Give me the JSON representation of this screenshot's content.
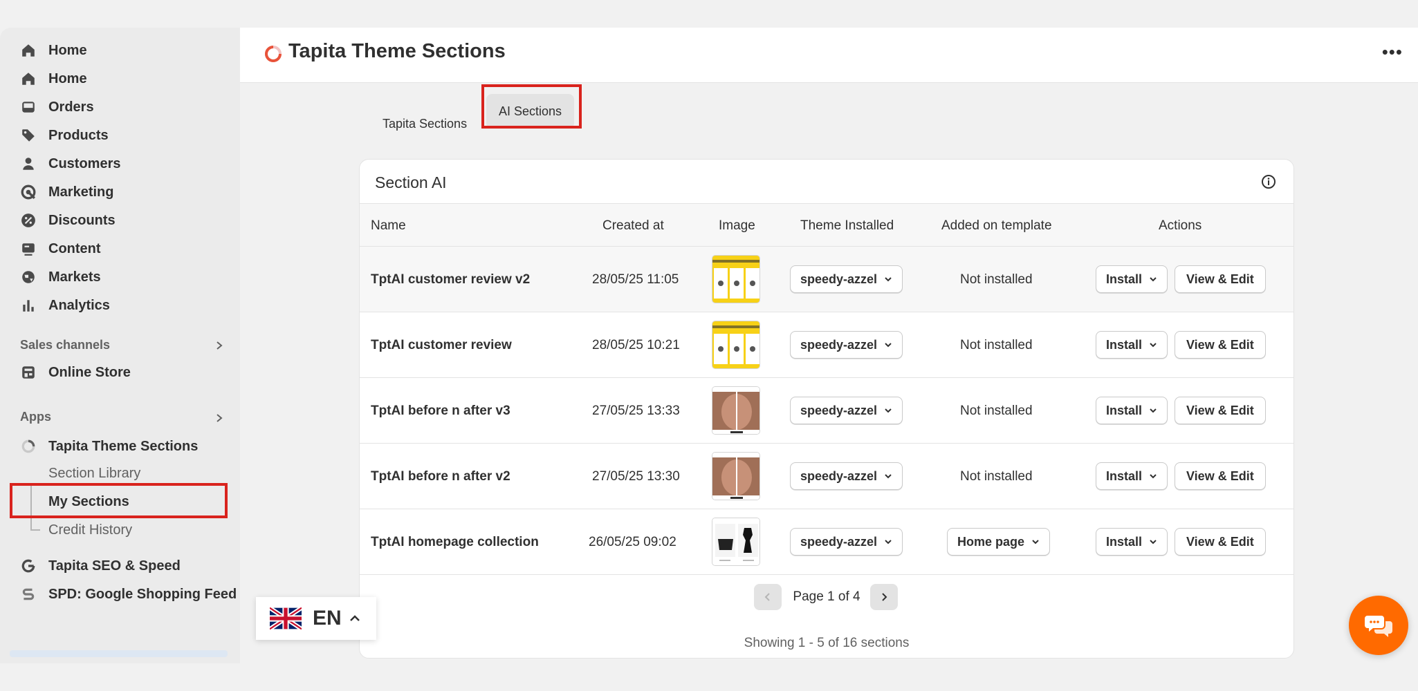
{
  "sidebar": {
    "items": [
      {
        "label": "Home",
        "icon": "home-icon"
      },
      {
        "label": "Home",
        "icon": "home-icon"
      },
      {
        "label": "Orders",
        "icon": "inbox-icon"
      },
      {
        "label": "Products",
        "icon": "tag-icon"
      },
      {
        "label": "Customers",
        "icon": "person-icon"
      },
      {
        "label": "Marketing",
        "icon": "target-icon"
      },
      {
        "label": "Discounts",
        "icon": "discount-icon"
      },
      {
        "label": "Content",
        "icon": "content-icon"
      },
      {
        "label": "Markets",
        "icon": "globe-icon"
      },
      {
        "label": "Analytics",
        "icon": "chart-bars-icon"
      }
    ],
    "sales_channels_label": "Sales channels",
    "online_store": "Online Store",
    "apps_label": "Apps",
    "app_name": "Tapita Theme Sections",
    "sub_items": [
      "Section Library",
      "My Sections",
      "Credit History"
    ],
    "other_apps": [
      "Tapita SEO & Speed",
      "SPD: Google Shopping Feed"
    ]
  },
  "header": {
    "title": "Tapita Theme Sections"
  },
  "tabs": [
    "Tapita Sections",
    "AI Sections"
  ],
  "card": {
    "title": "Section AI",
    "columns": [
      "Name",
      "Created at",
      "Image",
      "Theme Installed",
      "Added on template",
      "Actions"
    ],
    "rows": [
      {
        "name": "TptAI customer review v2",
        "created": "28/05/25 11:05",
        "image": "review-thumb",
        "theme": "speedy-azzel",
        "template": "Not installed"
      },
      {
        "name": "TptAI customer review",
        "created": "28/05/25 10:21",
        "image": "review-thumb",
        "theme": "speedy-azzel",
        "template": "Not installed"
      },
      {
        "name": "TptAI before n after v3",
        "created": "27/05/25 13:33",
        "image": "face-thumb",
        "theme": "speedy-azzel",
        "template": "Not installed"
      },
      {
        "name": "TptAI before n after v2",
        "created": "27/05/25 13:30",
        "image": "face-thumb",
        "theme": "speedy-azzel",
        "template": "Not installed"
      },
      {
        "name": "TptAI homepage collection",
        "created": "26/05/25 09:02",
        "image": "collection-thumb",
        "theme": "speedy-azzel",
        "template": "Home page"
      }
    ],
    "install_label": "Install",
    "view_edit_label": "View & Edit",
    "pager_label": "Page 1 of 4",
    "showing": "Showing 1 - 5 of 16 sections"
  },
  "language": {
    "code": "EN"
  },
  "colors": {
    "accent": "#ff6a00",
    "highlight": "#d9231d"
  }
}
